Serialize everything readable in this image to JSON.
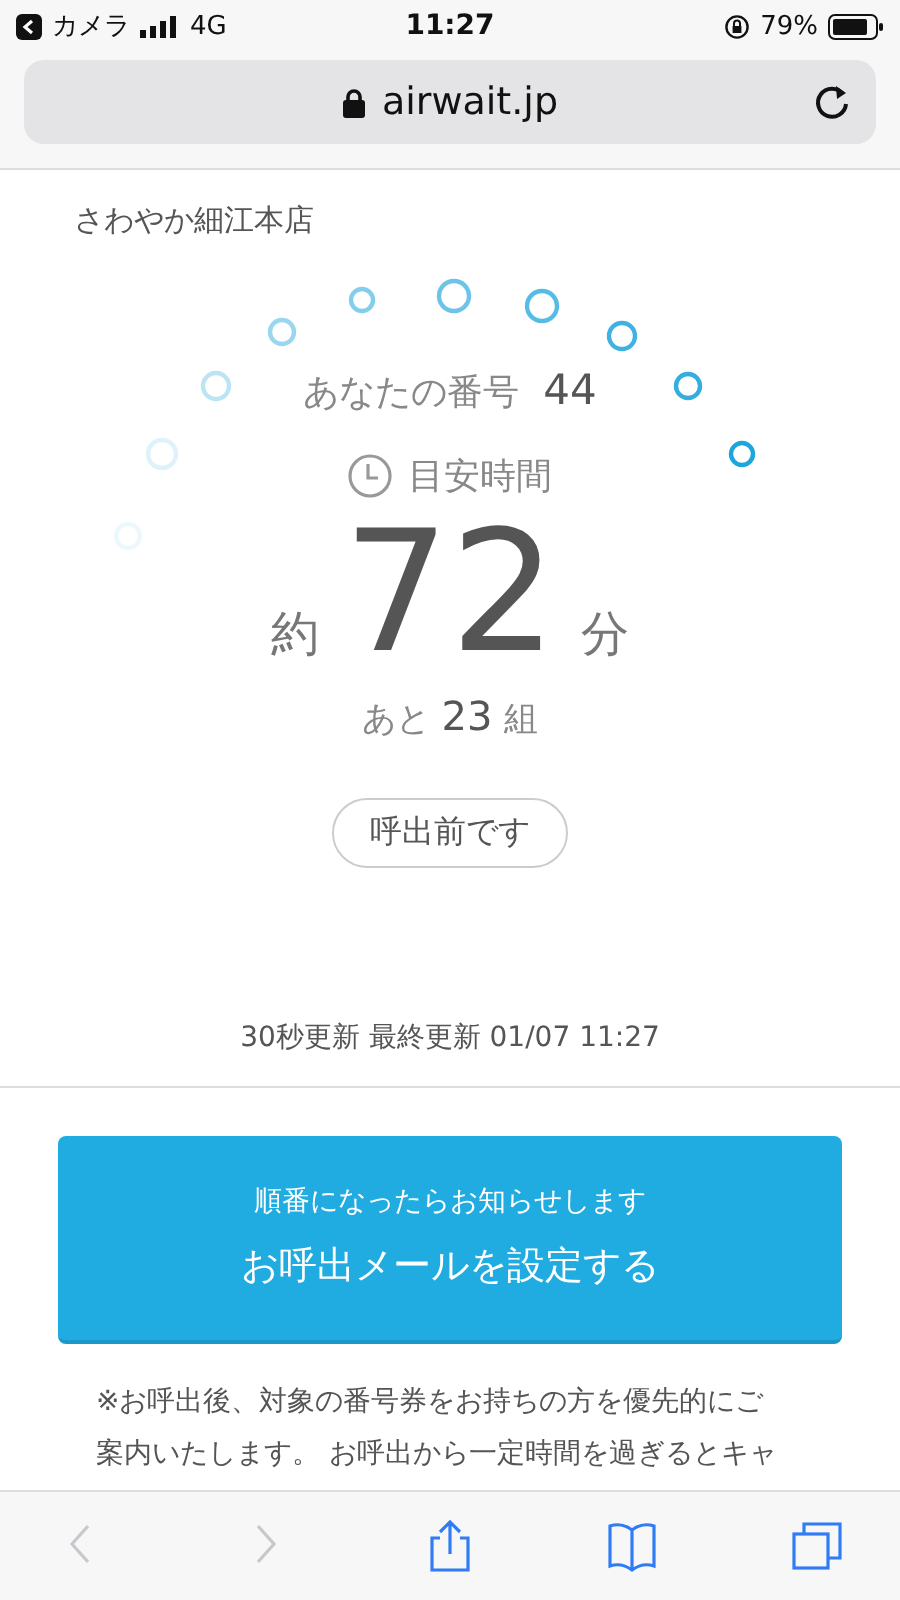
{
  "status_bar": {
    "back_app": "カメラ",
    "network": "4G",
    "time": "11:27",
    "battery": "79%"
  },
  "address_bar": {
    "url": "airwait.jp"
  },
  "store_name": "さわやか細江本店",
  "your_number": {
    "label": "あなたの番号",
    "value": "44"
  },
  "estimate": {
    "label": "目安時間",
    "prefix": "約",
    "minutes": "72",
    "unit": "分"
  },
  "remaining": {
    "prefix": "あと",
    "count": "23",
    "unit": "組"
  },
  "call_status": "呼出前です",
  "update_info": "30秒更新 最終更新 01/07 11:27",
  "mail_button": {
    "subtitle": "順番になったらお知らせします",
    "label": "お呼出メールを設定する"
  },
  "notice": "※お呼出後、対象の番号券をお持ちの方を優先的にご案内いたします。 お呼出から一定時間を過ぎるとキャ",
  "toolbar": [
    {
      "kind": "back",
      "disabled": true
    },
    {
      "kind": "forward",
      "disabled": true
    },
    {
      "kind": "share",
      "disabled": false
    },
    {
      "kind": "bookmarks",
      "disabled": false
    },
    {
      "kind": "tabs",
      "disabled": false
    }
  ]
}
